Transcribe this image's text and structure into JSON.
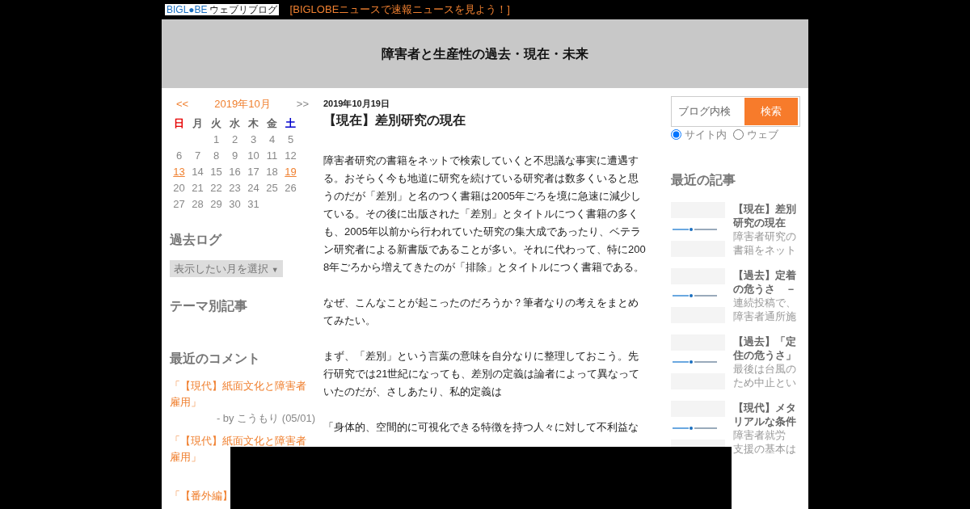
{
  "topbar": {
    "logo": {
      "text": "BIGL●BE",
      "sub": "ウェブリブログ"
    },
    "news_link": "[BIGLOBEニュースで速報ニュースを見よう！]"
  },
  "header": {
    "title": "障害者と生産性の過去・現在・未来"
  },
  "calendar": {
    "prev": "<<",
    "month": "2019年10月",
    "next": ">>",
    "weekdays": [
      {
        "label": "日",
        "color": "#e60000"
      },
      {
        "label": "月",
        "color": "#666666"
      },
      {
        "label": "火",
        "color": "#666666"
      },
      {
        "label": "水",
        "color": "#666666"
      },
      {
        "label": "木",
        "color": "#666666"
      },
      {
        "label": "金",
        "color": "#666666"
      },
      {
        "label": "土",
        "color": "#0000cc"
      }
    ],
    "weeks": [
      [
        {
          "day": "1",
          "linked": false
        },
        {
          "day": "2",
          "linked": false
        },
        {
          "day": "3",
          "linked": false
        },
        {
          "day": "4",
          "linked": false
        },
        {
          "day": "5",
          "linked": false
        }
      ],
      [
        {
          "day": "6",
          "linked": false
        },
        {
          "day": "7",
          "linked": false
        },
        {
          "day": "8",
          "linked": false
        },
        {
          "day": "9",
          "linked": false
        },
        {
          "day": "10",
          "linked": false
        },
        {
          "day": "11",
          "linked": false
        },
        {
          "day": "12",
          "linked": false
        }
      ],
      [
        {
          "day": "13",
          "linked": true
        },
        {
          "day": "14",
          "linked": false
        },
        {
          "day": "15",
          "linked": false
        },
        {
          "day": "16",
          "linked": false
        },
        {
          "day": "17",
          "linked": false
        },
        {
          "day": "18",
          "linked": false
        },
        {
          "day": "19",
          "linked": true
        }
      ],
      [
        {
          "day": "20",
          "linked": false
        },
        {
          "day": "21",
          "linked": false
        },
        {
          "day": "22",
          "linked": false
        },
        {
          "day": "23",
          "linked": false
        },
        {
          "day": "24",
          "linked": false
        },
        {
          "day": "25",
          "linked": false
        },
        {
          "day": "26",
          "linked": false
        }
      ],
      [
        {
          "day": "27",
          "linked": false
        },
        {
          "day": "28",
          "linked": false
        },
        {
          "day": "29",
          "linked": false
        },
        {
          "day": "30",
          "linked": false
        },
        {
          "day": "31",
          "linked": false
        }
      ]
    ]
  },
  "archive": {
    "heading": "過去ログ",
    "select": "表示したい月を選択",
    "caret": "▼"
  },
  "themes": {
    "heading": "テーマ別記事"
  },
  "comments": {
    "heading": "最近のコメント",
    "items": [
      {
        "title": "「【現代】紙面文化と障害者雇用」",
        "by": "- by こうもり (05/01)"
      },
      {
        "title": "「【現代】紙面文化と障害者雇用」"
      },
      {
        "title": "「【番外編】"
      }
    ]
  },
  "article": {
    "date": "2019年10月19日",
    "title": "【現在】差別研究の現在",
    "paragraphs": [
      "障害者研究の書籍をネットで検索していくと不思議な事実に遭遇する。おそらく今も地道に研究を続けている研究者は数多くいると思うのだが「差別」と名のつく書籍は2005年ごろを境に急速に減少している。その後に出版された「差別」とタイトルにつく書籍の多くも、2005年以前から行われていた研究の集大成であったり、ベテラン研究者による新書版であることが多い。それに代わって、特に2008年ごろから増えてきたのが「排除」とタイトルにつく書籍である。",
      "なぜ、こんなことが起こったのだろうか？筆者なりの考えをまとめてみたい。",
      "まず、「差別」という言葉の意味を自分なりに整理しておこう。先行研究では21世紀になっても、差別の定義は論者によって異なっていたのだが、さしあたり、私的定義は",
      "「身体的、空間的に可視化できる特徴を持つ人々に対して不利益な"
    ]
  },
  "search": {
    "placeholder": "ブログ内検",
    "button": "検索",
    "scopes": [
      {
        "label": "サイト内",
        "selected": true
      },
      {
        "label": "ウェブ",
        "selected": false
      }
    ]
  },
  "recent": {
    "heading": "最近の記事",
    "items": [
      {
        "title_lines": [
          "【現在】差別",
          "研究の現在"
        ],
        "excerpt_lines": [
          "障害者研究の",
          "書籍をネット"
        ]
      },
      {
        "title_lines": [
          "【過去】定着",
          "の危うさ　－"
        ],
        "excerpt_lines": [
          "連続投稿で、",
          "障害者通所施"
        ]
      },
      {
        "title_lines": [
          "【過去】「定",
          "住の危うさ」"
        ],
        "excerpt_lines": [
          "最後は台風の",
          "ため中止とい"
        ]
      },
      {
        "title_lines": [
          "【現代】メタ",
          "リアルな条件"
        ],
        "excerpt_lines": [
          "障害者就労",
          "支援の基本は"
        ]
      }
    ]
  }
}
